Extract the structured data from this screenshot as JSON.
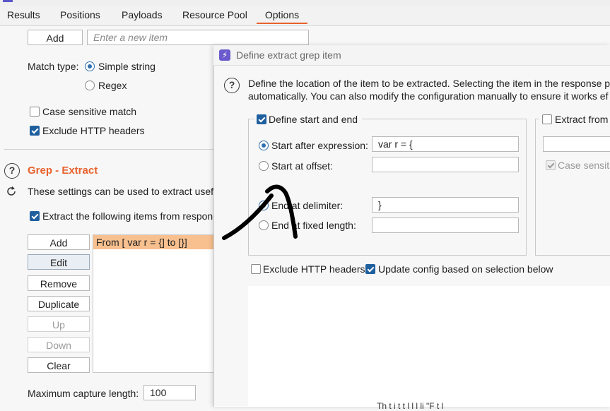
{
  "tabs": [
    "Results",
    "Positions",
    "Payloads",
    "Resource Pool",
    "Options"
  ],
  "active_tab": "Options",
  "accent_color": "#e8612c",
  "grep_match": {
    "add_label": "Add",
    "new_item_placeholder": "Enter a new item",
    "match_type_label": "Match type:",
    "simple_string_label": "Simple string",
    "regex_label": "Regex",
    "case_sensitive_label": "Case sensitive match",
    "exclude_headers_label": "Exclude HTTP headers"
  },
  "grep_extract": {
    "title": "Grep - Extract",
    "description": "These settings can be used to extract usefu",
    "extract_items_label": "Extract the following items from respon",
    "buttons": [
      "Add",
      "Edit",
      "Remove",
      "Duplicate",
      "Up",
      "Down",
      "Clear"
    ],
    "items": [
      "From [ var r = {] to [}]"
    ],
    "max_capture_label": "Maximum capture length:",
    "max_capture_value": "100"
  },
  "dialog": {
    "title": "Define extract grep item",
    "description_line1": "Define the location of the item to be extracted. Selecting the item in the response p",
    "description_line2": "automatically. You can also modify the configuration manually to ensure it works ef",
    "define_start_end_label": "Define start and end",
    "start_after_expression_label": "Start after expression:",
    "start_after_expression_value": "var r = {",
    "start_at_offset_label": "Start at offset:",
    "end_at_delimiter_label": "End at delimiter:",
    "end_at_delimiter_value": "}",
    "end_at_fixed_length_label": "End at fixed length:",
    "extract_from_label": "Extract from",
    "case_sensitive_label": "Case sensitiv",
    "exclude_headers_label": "Exclude HTTP headers",
    "update_config_label": "Update config based on selection below",
    "preview_text": "Th        t i                 t   t l     l        l    li  \"F  t l"
  }
}
